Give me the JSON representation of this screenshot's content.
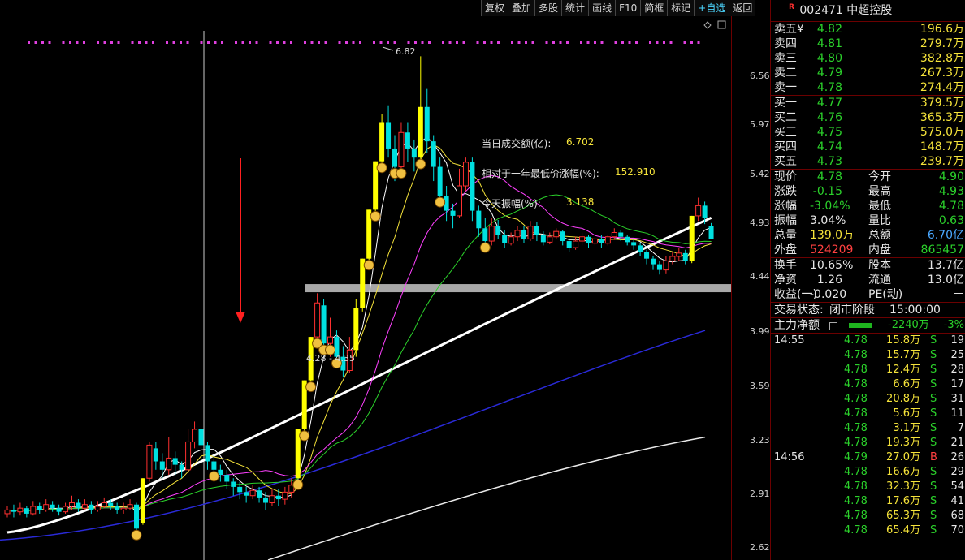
{
  "toolbar": [
    "复权",
    "叠加",
    "多股",
    "统计",
    "画线",
    "F10",
    "简框",
    "标记",
    "+自选",
    "返回"
  ],
  "price_axis": [
    "6.56",
    "5.97",
    "5.42",
    "4.93",
    "4.44",
    "3.99",
    "3.59",
    "3.23",
    "2.91",
    "2.62"
  ],
  "annotations": {
    "high_label": "6.82",
    "band_label": "4.28 - 4.35"
  },
  "info": {
    "turnover_label": "当日成交额(亿):",
    "turnover_value": "6.702",
    "gain_label": "相对于一年最低价涨幅(%):",
    "gain_value": "152.910",
    "amp_label": "今天振幅(%):",
    "amp_value": "3.138"
  },
  "stock": {
    "badge": "R",
    "code": "002471",
    "name": "中超控股"
  },
  "asks": [
    {
      "label": "卖五",
      "mark": "¥",
      "price": "4.82",
      "vol": "196.6万"
    },
    {
      "label": "卖四",
      "price": "4.81",
      "vol": "279.7万"
    },
    {
      "label": "卖三",
      "price": "4.80",
      "vol": "382.8万"
    },
    {
      "label": "卖二",
      "price": "4.79",
      "vol": "267.3万"
    },
    {
      "label": "卖一",
      "price": "4.78",
      "vol": "274.4万"
    }
  ],
  "bids": [
    {
      "label": "买一",
      "price": "4.77",
      "vol": "379.5万"
    },
    {
      "label": "买二",
      "price": "4.76",
      "vol": "365.3万"
    },
    {
      "label": "买三",
      "price": "4.75",
      "vol": "575.0万"
    },
    {
      "label": "买四",
      "price": "4.74",
      "vol": "148.7万"
    },
    {
      "label": "买五",
      "price": "4.73",
      "vol": "239.7万"
    }
  ],
  "stats": [
    {
      "l1": "现价",
      "v1": "4.78",
      "c1": "green",
      "l2": "今开",
      "v2": "4.90",
      "c2": "green"
    },
    {
      "l1": "涨跌",
      "v1": "-0.15",
      "c1": "green",
      "l2": "最高",
      "v2": "4.93",
      "c2": "green"
    },
    {
      "l1": "涨幅",
      "v1": "-3.04%",
      "c1": "green",
      "l2": "最低",
      "v2": "4.78",
      "c2": "green"
    },
    {
      "l1": "振幅",
      "v1": "3.04%",
      "c1": "white",
      "l2": "量比",
      "v2": "0.63",
      "c2": "green"
    },
    {
      "l1": "总量",
      "v1": "139.0万",
      "c1": "yellow",
      "l2": "总额",
      "v2": "6.70亿",
      "c2": "blue"
    },
    {
      "l1": "外盘",
      "v1": "524209",
      "c1": "red",
      "l2": "内盘",
      "v2": "865457",
      "c2": "green"
    }
  ],
  "stats2": [
    {
      "l1": "换手",
      "v1": "10.65%",
      "c1": "white",
      "l2": "股本",
      "v2": "13.7亿",
      "c2": "white"
    },
    {
      "l1": "净资",
      "v1": "1.26",
      "c1": "white",
      "l2": "流通",
      "v2": "13.0亿",
      "c2": "white"
    },
    {
      "l1": "收益(一)",
      "v1": "-0.020",
      "c1": "white",
      "l2": "PE(动)",
      "v2": "－",
      "c2": "white"
    }
  ],
  "status": {
    "label": "交易状态:",
    "value": "闭市阶段",
    "time": "15:00:00"
  },
  "main_flow": {
    "label": "主力净额",
    "value": "-2240万",
    "pct": "-3%"
  },
  "ticks": [
    {
      "time": "14:55",
      "price": "4.78",
      "vol": "15.8万",
      "side": "S",
      "cnt": "19"
    },
    {
      "time": "",
      "price": "4.78",
      "vol": "15.7万",
      "side": "S",
      "cnt": "25"
    },
    {
      "time": "",
      "price": "4.78",
      "vol": "12.4万",
      "side": "S",
      "cnt": "28"
    },
    {
      "time": "",
      "price": "4.78",
      "vol": "6.6万",
      "side": "S",
      "cnt": "17"
    },
    {
      "time": "",
      "price": "4.78",
      "vol": "20.8万",
      "side": "S",
      "cnt": "31"
    },
    {
      "time": "",
      "price": "4.78",
      "vol": "5.6万",
      "side": "S",
      "cnt": "11"
    },
    {
      "time": "",
      "price": "4.78",
      "vol": "3.1万",
      "side": "S",
      "cnt": "7"
    },
    {
      "time": "",
      "price": "4.78",
      "vol": "19.3万",
      "side": "S",
      "cnt": "21"
    },
    {
      "time": "14:56",
      "price": "4.79",
      "vol": "27.0万",
      "side": "B",
      "cnt": "26"
    },
    {
      "time": "",
      "price": "4.78",
      "vol": "16.6万",
      "side": "S",
      "cnt": "29"
    },
    {
      "time": "",
      "price": "4.78",
      "vol": "32.3万",
      "side": "S",
      "cnt": "54"
    },
    {
      "time": "",
      "price": "4.78",
      "vol": "17.6万",
      "side": "S",
      "cnt": "41"
    },
    {
      "time": "",
      "price": "4.78",
      "vol": "65.3万",
      "side": "S",
      "cnt": "68"
    },
    {
      "time": "",
      "price": "4.78",
      "vol": "65.4万",
      "side": "S",
      "cnt": "70"
    }
  ],
  "colors": {
    "up": "#ff3030",
    "down": "#00e0e0",
    "limit_up": "#ffff00",
    "ma5": "#ffffff",
    "ma10": "#f5e33a",
    "ma20": "#ff40ff",
    "ma30": "#2bd12b"
  },
  "candles": [
    [
      2.8,
      2.82,
      2.78,
      2.84
    ],
    [
      2.82,
      2.81,
      2.78,
      2.85
    ],
    [
      2.81,
      2.83,
      2.79,
      2.86
    ],
    [
      2.83,
      2.8,
      2.78,
      2.84
    ],
    [
      2.8,
      2.84,
      2.79,
      2.87
    ],
    [
      2.84,
      2.82,
      2.8,
      2.86
    ],
    [
      2.82,
      2.85,
      2.81,
      2.88
    ],
    [
      2.85,
      2.83,
      2.81,
      2.87
    ],
    [
      2.83,
      2.81,
      2.79,
      2.85
    ],
    [
      2.81,
      2.84,
      2.8,
      2.86
    ],
    [
      2.84,
      2.86,
      2.82,
      2.9
    ],
    [
      2.86,
      2.83,
      2.81,
      2.88
    ],
    [
      2.83,
      2.85,
      2.82,
      2.88
    ],
    [
      2.85,
      2.82,
      2.8,
      2.87
    ],
    [
      2.82,
      2.84,
      2.81,
      2.87
    ],
    [
      2.84,
      2.86,
      2.83,
      2.89
    ],
    [
      2.86,
      2.84,
      2.82,
      2.88
    ],
    [
      2.84,
      2.82,
      2.8,
      2.86
    ],
    [
      2.82,
      2.83,
      2.8,
      2.86
    ],
    [
      2.83,
      2.85,
      2.82,
      2.88
    ],
    [
      2.85,
      2.72,
      2.68,
      2.86
    ],
    [
      2.75,
      3.0,
      2.74,
      3.0
    ],
    [
      3.0,
      3.2,
      2.98,
      3.22
    ],
    [
      3.18,
      3.1,
      3.05,
      3.22
    ],
    [
      3.1,
      3.05,
      3.0,
      3.15
    ],
    [
      3.05,
      3.12,
      3.02,
      3.25
    ],
    [
      3.12,
      3.08,
      3.02,
      3.16
    ],
    [
      3.08,
      3.05,
      3.0,
      3.1
    ],
    [
      3.05,
      3.22,
      3.03,
      3.3
    ],
    [
      3.22,
      3.3,
      3.18,
      3.35
    ],
    [
      3.3,
      3.2,
      3.18,
      3.32
    ],
    [
      3.2,
      3.1,
      3.05,
      3.22
    ],
    [
      3.1,
      3.05,
      3.0,
      3.14
    ],
    [
      3.05,
      3.02,
      2.98,
      3.08
    ],
    [
      3.02,
      2.98,
      2.94,
      3.05
    ],
    [
      2.98,
      2.95,
      2.9,
      3.0
    ],
    [
      2.95,
      2.92,
      2.88,
      2.98
    ],
    [
      2.92,
      2.9,
      2.86,
      2.95
    ],
    [
      2.9,
      2.93,
      2.88,
      2.96
    ],
    [
      2.93,
      2.89,
      2.86,
      2.95
    ],
    [
      2.89,
      2.86,
      2.82,
      2.92
    ],
    [
      2.86,
      2.9,
      2.84,
      2.94
    ],
    [
      2.9,
      2.88,
      2.84,
      2.94
    ],
    [
      2.88,
      2.92,
      2.85,
      2.95
    ],
    [
      2.92,
      2.96,
      2.89,
      3.0
    ],
    [
      3.0,
      3.3,
      3.0,
      3.3
    ],
    [
      3.3,
      3.63,
      3.28,
      3.63
    ],
    [
      3.63,
      3.95,
      3.6,
      3.95
    ],
    [
      3.95,
      4.22,
      3.9,
      4.3
    ],
    [
      4.2,
      3.9,
      3.85,
      4.25
    ],
    [
      3.9,
      3.95,
      3.8,
      4.1
    ],
    [
      3.95,
      3.8,
      3.75,
      4.0
    ],
    [
      3.8,
      3.7,
      3.65,
      3.88
    ],
    [
      3.7,
      3.85,
      3.68,
      3.95
    ],
    [
      3.85,
      4.18,
      3.8,
      4.25
    ],
    [
      4.18,
      4.6,
      4.15,
      4.6
    ],
    [
      4.6,
      5.06,
      4.55,
      5.06
    ],
    [
      5.06,
      5.56,
      5.0,
      5.56
    ],
    [
      5.56,
      6.0,
      5.5,
      6.1
    ],
    [
      6.0,
      5.7,
      5.6,
      6.2
    ],
    [
      5.7,
      5.5,
      5.35,
      5.85
    ],
    [
      5.5,
      5.88,
      5.45,
      6.0
    ],
    [
      5.88,
      5.7,
      5.55,
      6.0
    ],
    [
      5.7,
      5.6,
      5.45,
      5.8
    ],
    [
      5.6,
      6.18,
      5.55,
      6.82
    ],
    [
      6.18,
      5.78,
      5.65,
      6.4
    ],
    [
      5.78,
      5.5,
      5.35,
      5.85
    ],
    [
      5.5,
      5.2,
      5.1,
      5.6
    ],
    [
      5.2,
      5.05,
      4.95,
      5.3
    ],
    [
      5.05,
      5.0,
      4.88,
      5.12
    ],
    [
      5.0,
      5.3,
      4.98,
      5.48
    ],
    [
      5.3,
      5.55,
      5.25,
      5.6
    ],
    [
      5.55,
      5.05,
      4.95,
      5.6
    ],
    [
      5.05,
      4.88,
      4.8,
      5.1
    ],
    [
      4.88,
      4.76,
      4.7,
      4.98
    ],
    [
      4.76,
      4.9,
      4.72,
      4.98
    ],
    [
      4.9,
      4.82,
      4.78,
      4.96
    ],
    [
      4.82,
      4.74,
      4.7,
      4.86
    ],
    [
      4.74,
      4.8,
      4.72,
      4.84
    ],
    [
      4.8,
      4.86,
      4.76,
      4.9
    ],
    [
      4.86,
      4.78,
      4.74,
      4.9
    ],
    [
      4.78,
      4.9,
      4.76,
      4.95
    ],
    [
      4.9,
      4.82,
      4.76,
      4.94
    ],
    [
      4.82,
      4.75,
      4.72,
      4.85
    ],
    [
      4.75,
      4.8,
      4.73,
      4.84
    ],
    [
      4.8,
      4.85,
      4.78,
      4.88
    ],
    [
      4.85,
      4.76,
      4.72,
      4.86
    ],
    [
      4.76,
      4.7,
      4.66,
      4.78
    ],
    [
      4.7,
      4.76,
      4.68,
      4.8
    ],
    [
      4.76,
      4.8,
      4.72,
      4.84
    ],
    [
      4.8,
      4.74,
      4.7,
      4.82
    ],
    [
      4.74,
      4.78,
      4.72,
      4.8
    ],
    [
      4.78,
      4.74,
      4.7,
      4.82
    ],
    [
      4.74,
      4.8,
      4.72,
      4.82
    ],
    [
      4.8,
      4.84,
      4.77,
      4.88
    ],
    [
      4.84,
      4.8,
      4.76,
      4.86
    ],
    [
      4.8,
      4.75,
      4.72,
      4.82
    ],
    [
      4.75,
      4.72,
      4.68,
      4.78
    ],
    [
      4.72,
      4.66,
      4.62,
      4.74
    ],
    [
      4.66,
      4.6,
      4.55,
      4.68
    ],
    [
      4.6,
      4.55,
      4.5,
      4.62
    ],
    [
      4.55,
      4.5,
      4.46,
      4.58
    ],
    [
      4.5,
      4.58,
      4.47,
      4.62
    ],
    [
      4.58,
      4.62,
      4.55,
      4.66
    ],
    [
      4.62,
      4.65,
      4.58,
      4.7
    ],
    [
      4.65,
      4.58,
      4.55,
      4.68
    ],
    [
      4.58,
      5.0,
      4.56,
      5.0
    ],
    [
      5.0,
      5.1,
      4.95,
      5.18
    ],
    [
      5.1,
      4.98,
      4.92,
      5.14
    ],
    [
      4.9,
      4.78,
      4.78,
      4.93
    ]
  ]
}
